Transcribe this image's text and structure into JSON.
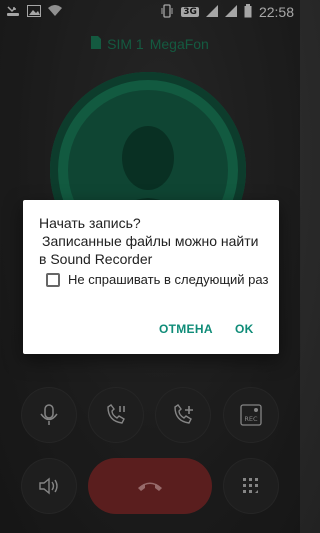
{
  "status_bar": {
    "time": "22:58",
    "network_type": "3G",
    "left_icons": [
      "missed-call-icon",
      "image-icon",
      "wifi-icon"
    ],
    "right_icons": [
      "vibrate-icon",
      "signal-icon",
      "signal-icon",
      "battery-icon"
    ]
  },
  "call": {
    "sim_label": "SIM 1",
    "carrier": "MegaFon"
  },
  "controls": {
    "icons": [
      "mute-icon",
      "hold-icon",
      "add-call-icon",
      "record-icon",
      "speaker-icon",
      "end-call-icon",
      "dialpad-icon"
    ],
    "record_label": "REC"
  },
  "dialog": {
    "title": "Начать запись?",
    "message_line1": "Записанные файлы можно найти",
    "message_line2": "в Sound Recorder",
    "checkbox_label": "Не спрашивать в следующий раз",
    "cancel_label": "ОТМЕНА",
    "ok_label": "OK"
  },
  "colors": {
    "accent": "#0f8c78",
    "avatar": "#1d8a63",
    "end_call": "#8a2f2f"
  }
}
